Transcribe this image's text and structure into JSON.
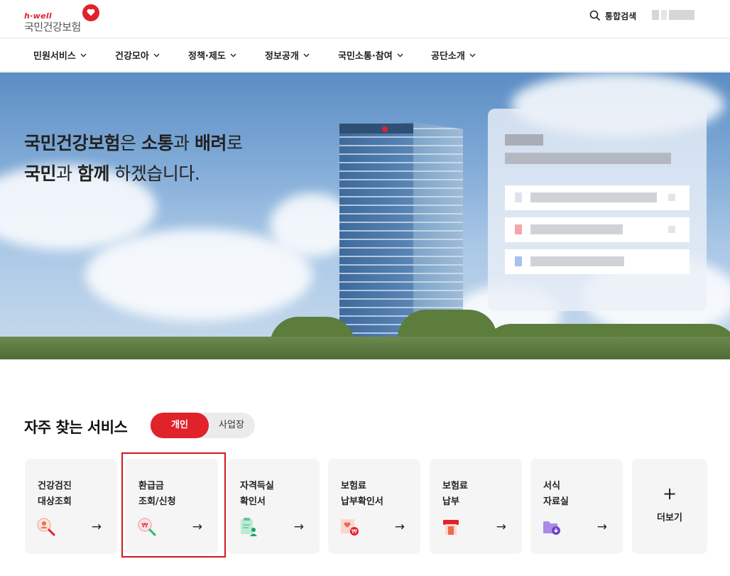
{
  "header": {
    "logo_sub": "h·well",
    "logo_main": "국민건강보험",
    "search_label": "통합검색"
  },
  "nav": {
    "items": [
      {
        "label": "민원서비스"
      },
      {
        "label": "건강모아"
      },
      {
        "label": "정책·제도"
      },
      {
        "label": "정보공개"
      },
      {
        "label": "국민소통·참여"
      },
      {
        "label": "공단소개"
      }
    ]
  },
  "hero": {
    "line1_strong1": "국민건강보험",
    "line1_t1": "은 ",
    "line1_strong2": "소통",
    "line1_t2": "과 ",
    "line1_strong3": "배려",
    "line1_t3": "로",
    "line2_strong1": "국민",
    "line2_t1": "과 ",
    "line2_strong2": "함께",
    "line2_t2": " 하겠습니다."
  },
  "services": {
    "title": "자주 찾는 서비스",
    "tab_personal": "개인",
    "tab_business": "사업장",
    "cards": [
      {
        "l1": "건강검진",
        "l2": "대상조회",
        "icon": "search-person-icon",
        "arrow": "→"
      },
      {
        "l1": "환급금",
        "l2": "조회/신청",
        "icon": "refund-search-icon",
        "arrow": "→"
      },
      {
        "l1": "자격득실",
        "l2": "확인서",
        "icon": "document-person-icon",
        "arrow": "→"
      },
      {
        "l1": "보험료",
        "l2": "납부확인서",
        "icon": "payment-certificate-icon",
        "arrow": "→"
      },
      {
        "l1": "보험료",
        "l2": "납부",
        "icon": "payment-icon",
        "arrow": "→"
      },
      {
        "l1": "서식",
        "l2": "자료실",
        "icon": "folder-download-icon",
        "arrow": "→"
      }
    ],
    "more_icon": "+",
    "more_label": "더보기"
  },
  "colors": {
    "brand_red": "#e0222b",
    "card_bg": "#f5f5f5"
  }
}
